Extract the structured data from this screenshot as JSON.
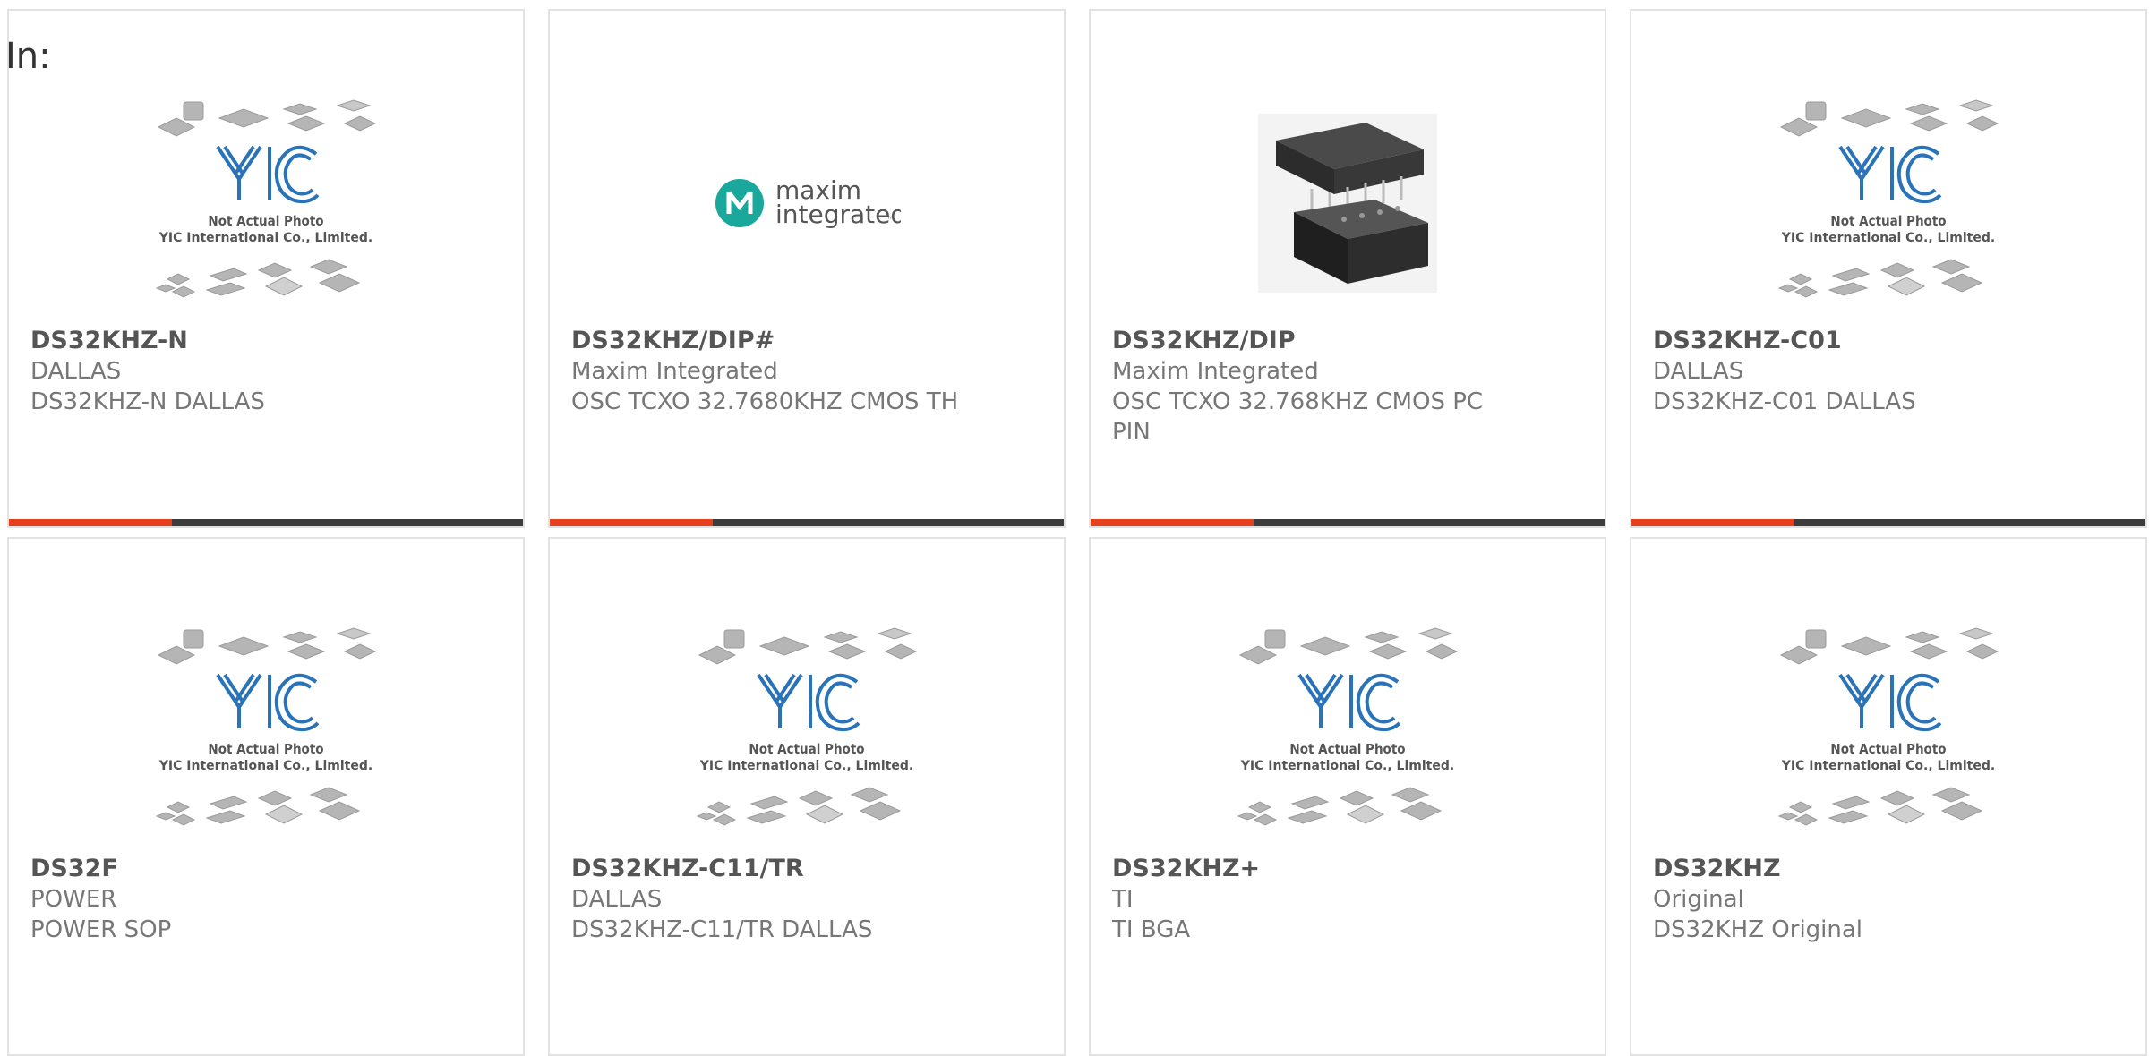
{
  "page": {
    "in_label": "In:"
  },
  "placeholder": {
    "line1": "Not Actual Photo",
    "line2": "YIC International Co., Limited.",
    "logo_text": "YIC"
  },
  "maxim_logo": {
    "line1": "maxim",
    "line2": "integrated",
    "tm": "™",
    "color": "#1aa89c"
  },
  "colors": {
    "accent": "#e8401c",
    "bar": "#3c3c3c",
    "yic_blue": "#2a73b8"
  },
  "products": [
    {
      "pn": "DS32KHZ-N",
      "mfr": "DALLAS",
      "desc": "DS32KHZ-N DALLAS",
      "image": "yic-placeholder"
    },
    {
      "pn": "DS32KHZ/DIP#",
      "mfr": "Maxim Integrated",
      "desc": "OSC TCXO 32.7680KHZ CMOS TH",
      "image": "maxim-logo"
    },
    {
      "pn": "DS32KHZ/DIP",
      "mfr": "Maxim Integrated",
      "desc": "OSC TCXO 32.768KHZ CMOS PC PIN",
      "image": "dip-module-photo"
    },
    {
      "pn": "DS32KHZ-C01",
      "mfr": "DALLAS",
      "desc": "DS32KHZ-C01 DALLAS",
      "image": "yic-placeholder"
    },
    {
      "pn": "DS32F",
      "mfr": "POWER",
      "desc": "POWER SOP",
      "image": "yic-placeholder"
    },
    {
      "pn": "DS32KHZ-C11/TR",
      "mfr": "DALLAS",
      "desc": "DS32KHZ-C11/TR DALLAS",
      "image": "yic-placeholder"
    },
    {
      "pn": "DS32KHZ+",
      "mfr": "TI",
      "desc": "TI BGA",
      "image": "yic-placeholder"
    },
    {
      "pn": "DS32KHZ",
      "mfr": "Original",
      "desc": "DS32KHZ Original",
      "image": "yic-placeholder"
    }
  ]
}
